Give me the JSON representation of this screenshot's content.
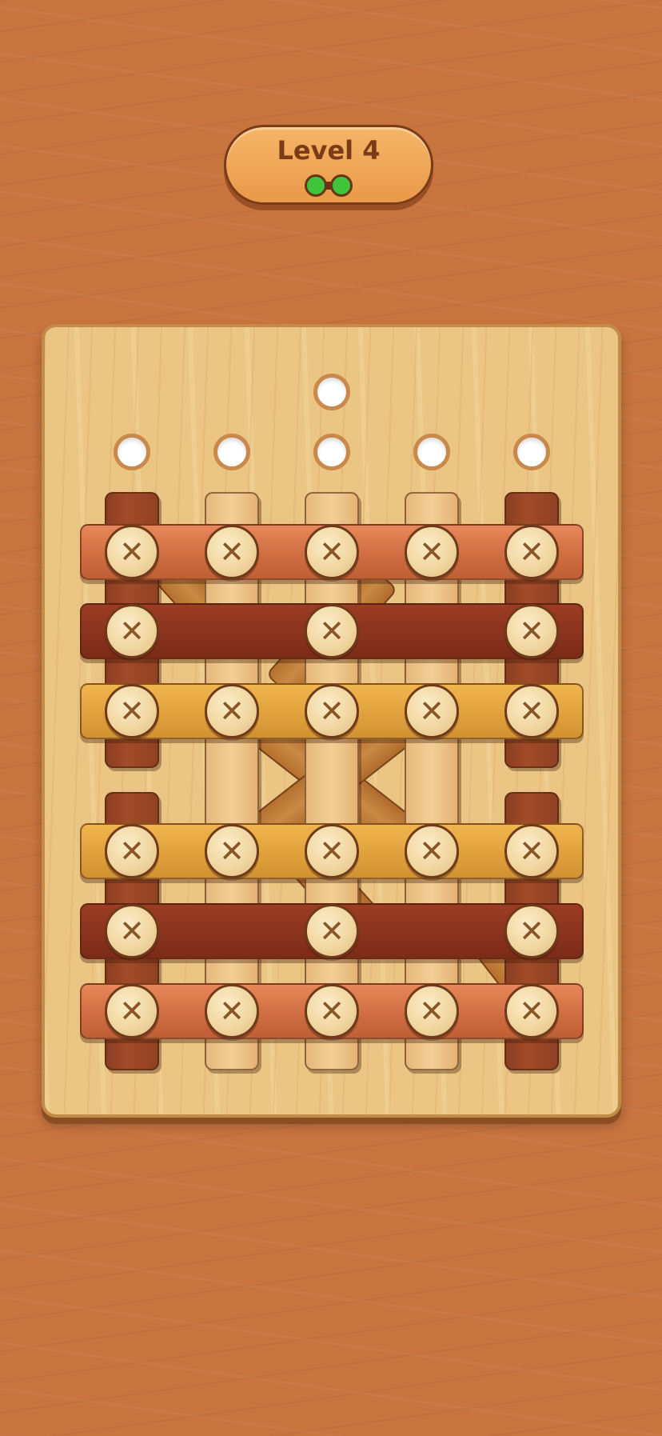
{
  "level": {
    "title": "Level 4",
    "progress_dots": 2,
    "dot_color": "#3fc43c"
  },
  "board": {
    "empty_holes": 6,
    "vertical_planks": [
      "dark",
      "light",
      "light",
      "light",
      "dark",
      "dark",
      "dark"
    ],
    "horizontal_planks": [
      "copper",
      "maroon",
      "gold",
      "gold",
      "maroon",
      "copper"
    ],
    "screw_glyph": "✕",
    "screws_per_row": [
      5,
      3,
      5,
      5,
      3,
      5
    ]
  },
  "colors": {
    "background": "#c8743f",
    "board": "#ebc583",
    "copper": "#d6774a",
    "maroon": "#8a331d",
    "gold": "#e0a13c"
  }
}
